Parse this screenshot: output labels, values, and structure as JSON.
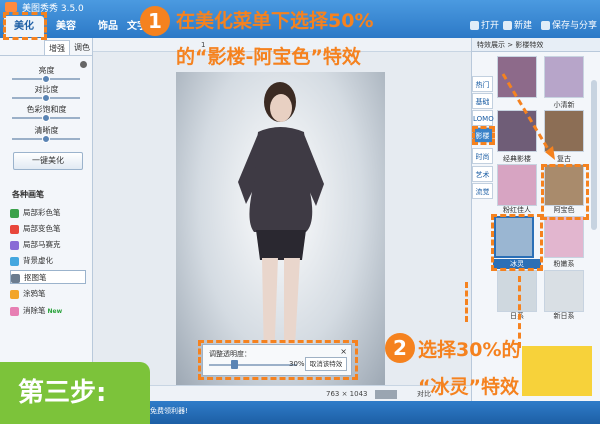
{
  "app": {
    "title": "美图秀秀 3.5.0"
  },
  "menu_tabs": [
    {
      "label": "美化"
    },
    {
      "label": "美容"
    },
    {
      "label": "饰品"
    },
    {
      "label": "文字"
    }
  ],
  "toolbar_right": {
    "open_label": "打开",
    "new_label": "新建",
    "save_label": "保存与分享"
  },
  "left_panel": {
    "subtabs": [
      "增强",
      "调色"
    ],
    "sliders": [
      {
        "label": "亮度",
        "level": 0.5
      },
      {
        "label": "对比度",
        "level": 0.5
      },
      {
        "label": "色彩饱和度",
        "level": 0.5
      },
      {
        "label": "清晰度",
        "level": 0.5
      }
    ],
    "one_click_button": "一键美化",
    "brushes_title": "各种画笔",
    "brushes": [
      {
        "label": "局部彩色笔",
        "color": "#3aa14a"
      },
      {
        "label": "局部变色笔",
        "color": "#e8463b"
      },
      {
        "label": "局部马赛克",
        "color": "#8a6bd6"
      },
      {
        "label": "背景虚化",
        "color": "#44a7df"
      },
      {
        "label": "抠图笔",
        "color": "#6b7c8f"
      },
      {
        "label": "涂鸦笔",
        "color": "#f2a52b"
      },
      {
        "label": "消除笔",
        "color": "#e77fb3"
      }
    ],
    "new_tag": "New"
  },
  "canvas": {
    "zoom_label": "1",
    "image_size": "763 × 1043",
    "compare_label": "对比",
    "dialog": {
      "title": "调整透明度：",
      "percent": "30%",
      "cancel_label": "取消该特效",
      "level": 0.3
    }
  },
  "right_panel": {
    "breadcrumb": "特效展示 > 影楼特效",
    "categories": [
      "热门",
      "基础",
      "LOMO",
      "影楼",
      "时尚",
      "艺术",
      "流觉"
    ],
    "effects": [
      {
        "label": "",
        "tone": "#8d6a8a"
      },
      {
        "label": "",
        "tone": "#b7a5c9"
      },
      {
        "label": "",
        "tone": "#3c3a5a"
      },
      {
        "label": "小清新",
        "tone": "#c8d8e8"
      },
      {
        "label": "经典影楼",
        "tone": "#6f5d77"
      },
      {
        "label": "复古",
        "tone": "#8c6e55"
      },
      {
        "label": "粉红佳人",
        "tone": "#d7a4c2"
      },
      {
        "label": "阿宝色",
        "tone": "#a98b6c"
      },
      {
        "label": "冰灵",
        "tone": "#9ab6d2"
      },
      {
        "label": "粉嫩系",
        "tone": "#e2b6cf"
      },
      {
        "label": "日系",
        "tone": "#cfd8df"
      },
      {
        "label": "新日系",
        "tone": "#d9dfe4"
      }
    ],
    "selected": "冰灵"
  },
  "annotations": {
    "step1_number": "1",
    "step1_line1": "在美化菜单下选择50%",
    "step1_line2": "的“影楼-阿宝色”特效",
    "step2_number": "2",
    "step2_line1": "选择30%的",
    "step2_line2": "“冰灵”特效",
    "step3": "第三步:"
  },
  "bottom_bar": {
    "text": "免费领利器!"
  },
  "colors": {
    "accent": "#f5821f",
    "title_bar": "#2c79c7",
    "step3_bg": "#7cc33a"
  }
}
